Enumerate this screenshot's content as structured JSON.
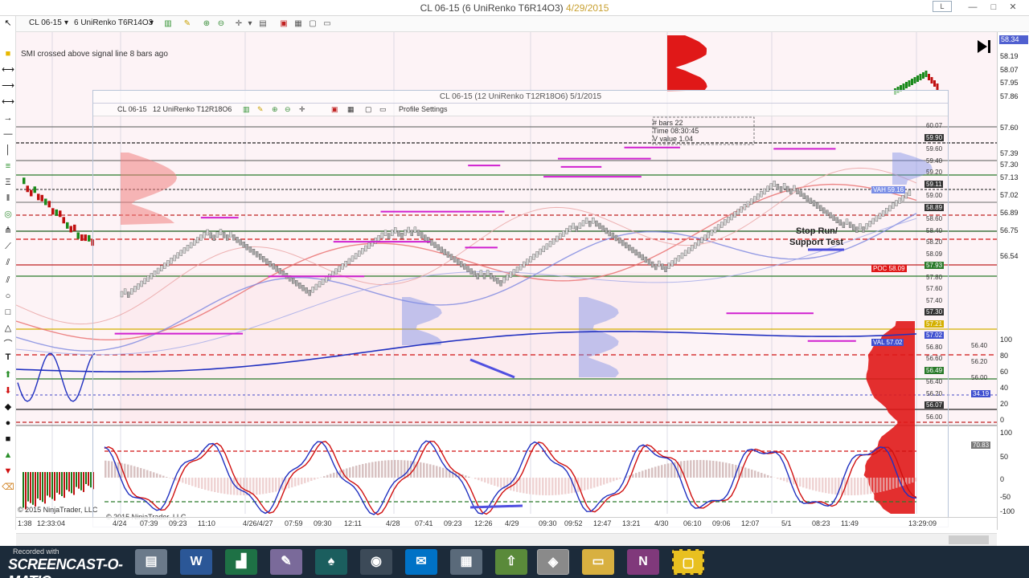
{
  "window": {
    "title_prefix": "CL 06-15 (6 UniRenko T6R14O3) ",
    "title_date": "4/29/2015",
    "layout_btn": "L",
    "min_btn": "—",
    "max_btn": "□",
    "close_btn": "✕"
  },
  "toolbar": {
    "instrument": "CL 06-15",
    "bar_type": "6 UniRenko T6R14O3"
  },
  "inner": {
    "title": "CL 06-15 (12 UniRenko T12R18O6)  5/1/2015",
    "instrument": "CL 06-15",
    "bar_type": "12 UniRenko T12R18O6",
    "profile_settings": "Profile Settings"
  },
  "annotations": {
    "smi_msg": "SMI crossed above signal line 8 bars ago",
    "stop_run_1": "Stop Run/",
    "stop_run_2": "Support Test",
    "copyright_outer": "© 2015 NinjaTrader, LLC",
    "copyright_inner": "© 2015 NinjaTrader, LLC",
    "info_bars": "# bars   22",
    "info_time": "Time   08:30:45",
    "info_value": "V value  1.04"
  },
  "price_scale": {
    "labels": [
      "58.34",
      "58.19",
      "58.07",
      "57.95",
      "57.86",
      "57.60",
      "57.39",
      "57.30",
      "57.13",
      "57.02",
      "56.89",
      "56.75",
      "56.54"
    ],
    "top_tag": "58.34",
    "bottom_labels": [
      "100",
      "80",
      "60",
      "40",
      "20",
      "0"
    ],
    "stoch_labels": [
      "100",
      "80",
      "60",
      "40",
      "20",
      "0"
    ],
    "cci_labels": [
      "100",
      "50",
      "0",
      "-50",
      "-100"
    ]
  },
  "inner_prices": {
    "labels": [
      "60.07",
      "59.90",
      "59.60",
      "59.40",
      "59.20",
      "59.11",
      "59.00",
      "58.89",
      "58.60",
      "58.40",
      "58.20",
      "58.09",
      "57.93",
      "57.80",
      "57.60",
      "57.40",
      "57.30",
      "57.21",
      "57.02",
      "56.80",
      "56.60",
      "56.49",
      "56.40",
      "56.20",
      "56.07",
      "56.00"
    ],
    "poc": "POC 58.09",
    "val": "VAL 57.02",
    "vah": "VAH 59.16"
  },
  "right_extra": {
    "labels": [
      "56.40",
      "56.20",
      "56.00",
      "34.19",
      "70.83"
    ]
  },
  "time_axis": {
    "clock_left": "1:38",
    "clock_mid": "12:33:04",
    "clock_right": "13:29:09",
    "ticks": [
      "4/24",
      "07:39",
      "09:23",
      "11:10",
      "4/26/4/27",
      "07:59",
      "09:30",
      "12:11",
      "4/28",
      "07:41",
      "09:23",
      "12:26",
      "4/29",
      "09:30",
      "09:52",
      "12:47",
      "13:21",
      "4/30",
      "06:10",
      "09:06",
      "12:07",
      "5/1",
      "08:23",
      "11:49"
    ]
  },
  "taskbar": {
    "recorded_with": "Recorded with",
    "brand": "SCREENCAST-O-MATIC",
    "word": "W",
    "onenote": "N"
  },
  "colors": {
    "bull": "#2a8f2a",
    "bear": "#d01010",
    "profile_red": "#e01818",
    "profile_blue": "#7c8fe6",
    "accent": "#2040c0"
  }
}
